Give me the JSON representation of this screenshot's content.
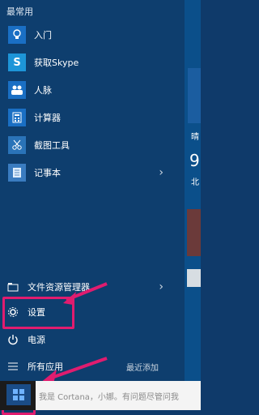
{
  "menu": {
    "section_title": "最常用",
    "frequent": [
      {
        "label": "入门",
        "icon": "lightbulb-icon"
      },
      {
        "label": "获取Skype",
        "icon": "skype-icon"
      },
      {
        "label": "人脉",
        "icon": "people-icon"
      },
      {
        "label": "计算器",
        "icon": "calculator-icon"
      },
      {
        "label": "截图工具",
        "icon": "scissors-icon"
      },
      {
        "label": "记事本",
        "icon": "notepad-icon",
        "submenu": "›"
      }
    ],
    "bottom": [
      {
        "label": "文件资源管理器",
        "icon": "folder-icon",
        "submenu": "›"
      },
      {
        "label": "设置",
        "icon": "gear-icon"
      },
      {
        "label": "电源",
        "icon": "power-icon"
      },
      {
        "label": "所有应用",
        "icon": "list-icon"
      }
    ],
    "new_label": "最近添加"
  },
  "tiles": {
    "clock_char": "9",
    "fragment_top": "晴",
    "fragment_mid": "北"
  },
  "taskbar": {
    "search_placeholder": "我是 Cortana，小娜。有问题尽管问我"
  },
  "colors": {
    "highlight": "#e01c6f",
    "accent": "#1a4c86"
  }
}
